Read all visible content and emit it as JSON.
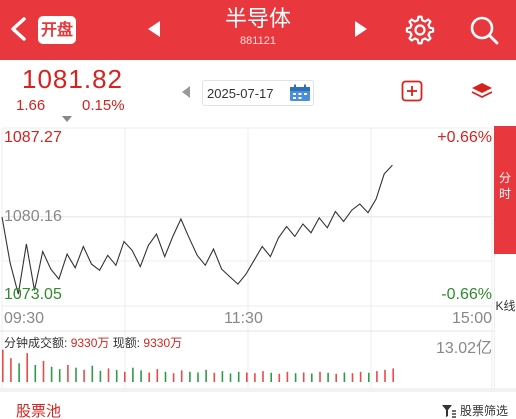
{
  "header": {
    "open_label": "开盘",
    "title": "半导体",
    "code": "881121",
    "bg_color": "#e8383d"
  },
  "quote": {
    "price": "1081.82",
    "change": "1.66",
    "change_pct": "0.15%",
    "date": "2025-07-17"
  },
  "chart_data": {
    "type": "line",
    "title": "",
    "y_top_label": "1087.27",
    "y_mid_label": "1080.16",
    "y_bottom_label": "1073.05",
    "pct_top_label": "+0.66%",
    "pct_bottom_label": "-0.66%",
    "x_labels": [
      "09:30",
      "11:30",
      "15:00"
    ],
    "ylim": [
      1073.05,
      1087.27
    ],
    "series": [
      {
        "values": [
          1080.16,
          1076.5,
          1074.0,
          1078.0,
          1074.3,
          1077.4,
          1076.0,
          1075.2,
          1077.2,
          1076.1,
          1077.8,
          1076.4,
          1075.9,
          1077.1,
          1076.3,
          1078.2,
          1077.5,
          1076.2,
          1077.9,
          1078.8,
          1077.0,
          1078.6,
          1080.0,
          1078.5,
          1077.1,
          1076.3,
          1077.6,
          1076.0,
          1075.4,
          1074.8,
          1075.6,
          1076.7,
          1077.8,
          1077.0,
          1078.5,
          1079.4,
          1078.6,
          1079.6,
          1078.9,
          1080.1,
          1079.3,
          1080.6,
          1079.8,
          1080.7,
          1081.2,
          1080.5,
          1081.6,
          1083.6,
          1084.3
        ]
      }
    ],
    "volume_bars": [
      0.95,
      0.7,
      0.55,
      0.85,
      0.5,
      0.62,
      0.45,
      0.38,
      0.5,
      0.42,
      0.36,
      0.48,
      0.33,
      0.4,
      0.35,
      0.3,
      0.42,
      0.34,
      0.28,
      0.38,
      0.3,
      0.26,
      0.34,
      0.3,
      0.28,
      0.36,
      0.27,
      0.32,
      0.25,
      0.3,
      0.28,
      0.26,
      0.32,
      0.27,
      0.24,
      0.3,
      0.26,
      0.28,
      0.25,
      0.3,
      0.27,
      0.24,
      0.28,
      0.26,
      0.3,
      0.27,
      0.32,
      0.36,
      0.4
    ],
    "volume_colors": [
      "r",
      "r",
      "g",
      "r",
      "g",
      "r",
      "g",
      "g",
      "r",
      "g",
      "r",
      "g",
      "g",
      "r",
      "g",
      "r",
      "g",
      "g",
      "r",
      "r",
      "g",
      "r",
      "r",
      "g",
      "g",
      "g",
      "r",
      "g",
      "g",
      "g",
      "r",
      "r",
      "r",
      "g",
      "r",
      "r",
      "g",
      "r",
      "g",
      "r",
      "g",
      "r",
      "g",
      "r",
      "r",
      "g",
      "r",
      "r",
      "r"
    ]
  },
  "volume": {
    "label": "分钟成交额:",
    "value1": "9330万",
    "label2": "现额:",
    "value2": "9330万",
    "max": "13.02亿"
  },
  "tabs": {
    "fen": "分时",
    "k": "K线"
  },
  "bottom": {
    "pool": "股票池",
    "filter": "股票筛选"
  }
}
